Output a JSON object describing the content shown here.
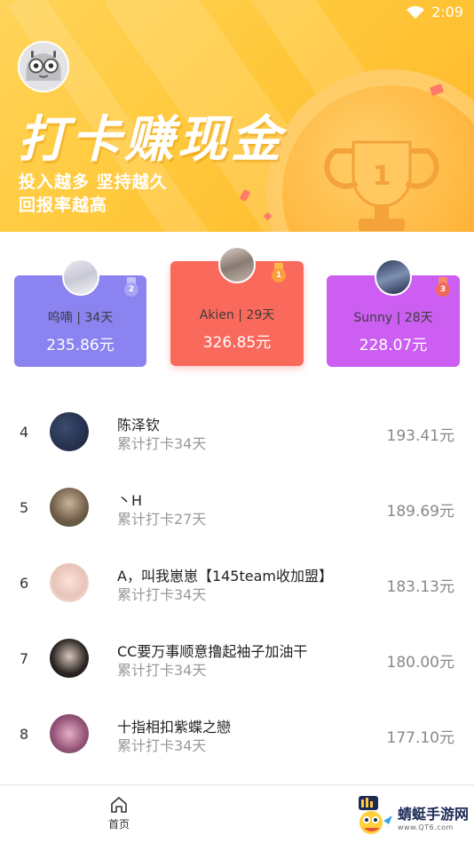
{
  "status_bar": {
    "time": "2:09"
  },
  "banner": {
    "headline": "打卡赚现金",
    "line1": "投入越多  坚持越久",
    "line2": "回报率越高",
    "trophy_number": "1"
  },
  "podium": [
    {
      "rank": "2",
      "name": "呜喃  | 34天",
      "amount": "235.86元"
    },
    {
      "rank": "1",
      "name": "Akien  | 29天",
      "amount": "326.85元"
    },
    {
      "rank": "3",
      "name": "Sunny  | 28天",
      "amount": "228.07元"
    }
  ],
  "list": [
    {
      "rank": "4",
      "name": "陈泽钦",
      "sub": "累计打卡34天",
      "amount": "193.41元"
    },
    {
      "rank": "5",
      "name": "丶H",
      "sub": "累计打卡27天",
      "amount": "189.69元"
    },
    {
      "rank": "6",
      "name": "A，叫我崽崽【145team收加盟】",
      "sub": "累计打卡34天",
      "amount": "183.13元"
    },
    {
      "rank": "7",
      "name": "CC要万事顺意撸起袖子加油干",
      "sub": "累计打卡34天",
      "amount": "180.00元"
    },
    {
      "rank": "8",
      "name": "十指相扣紫蝶之戀",
      "sub": "累计打卡34天",
      "amount": "177.10元"
    }
  ],
  "bottom_nav": {
    "home_label": "首页"
  },
  "watermark": {
    "title": "蜻蜓手游网",
    "url": "www.QT6.com"
  },
  "colors": {
    "gold": "#ffc93c",
    "second": "#8a83f0",
    "first": "#fa6a5c",
    "third": "#cc5ef2"
  }
}
